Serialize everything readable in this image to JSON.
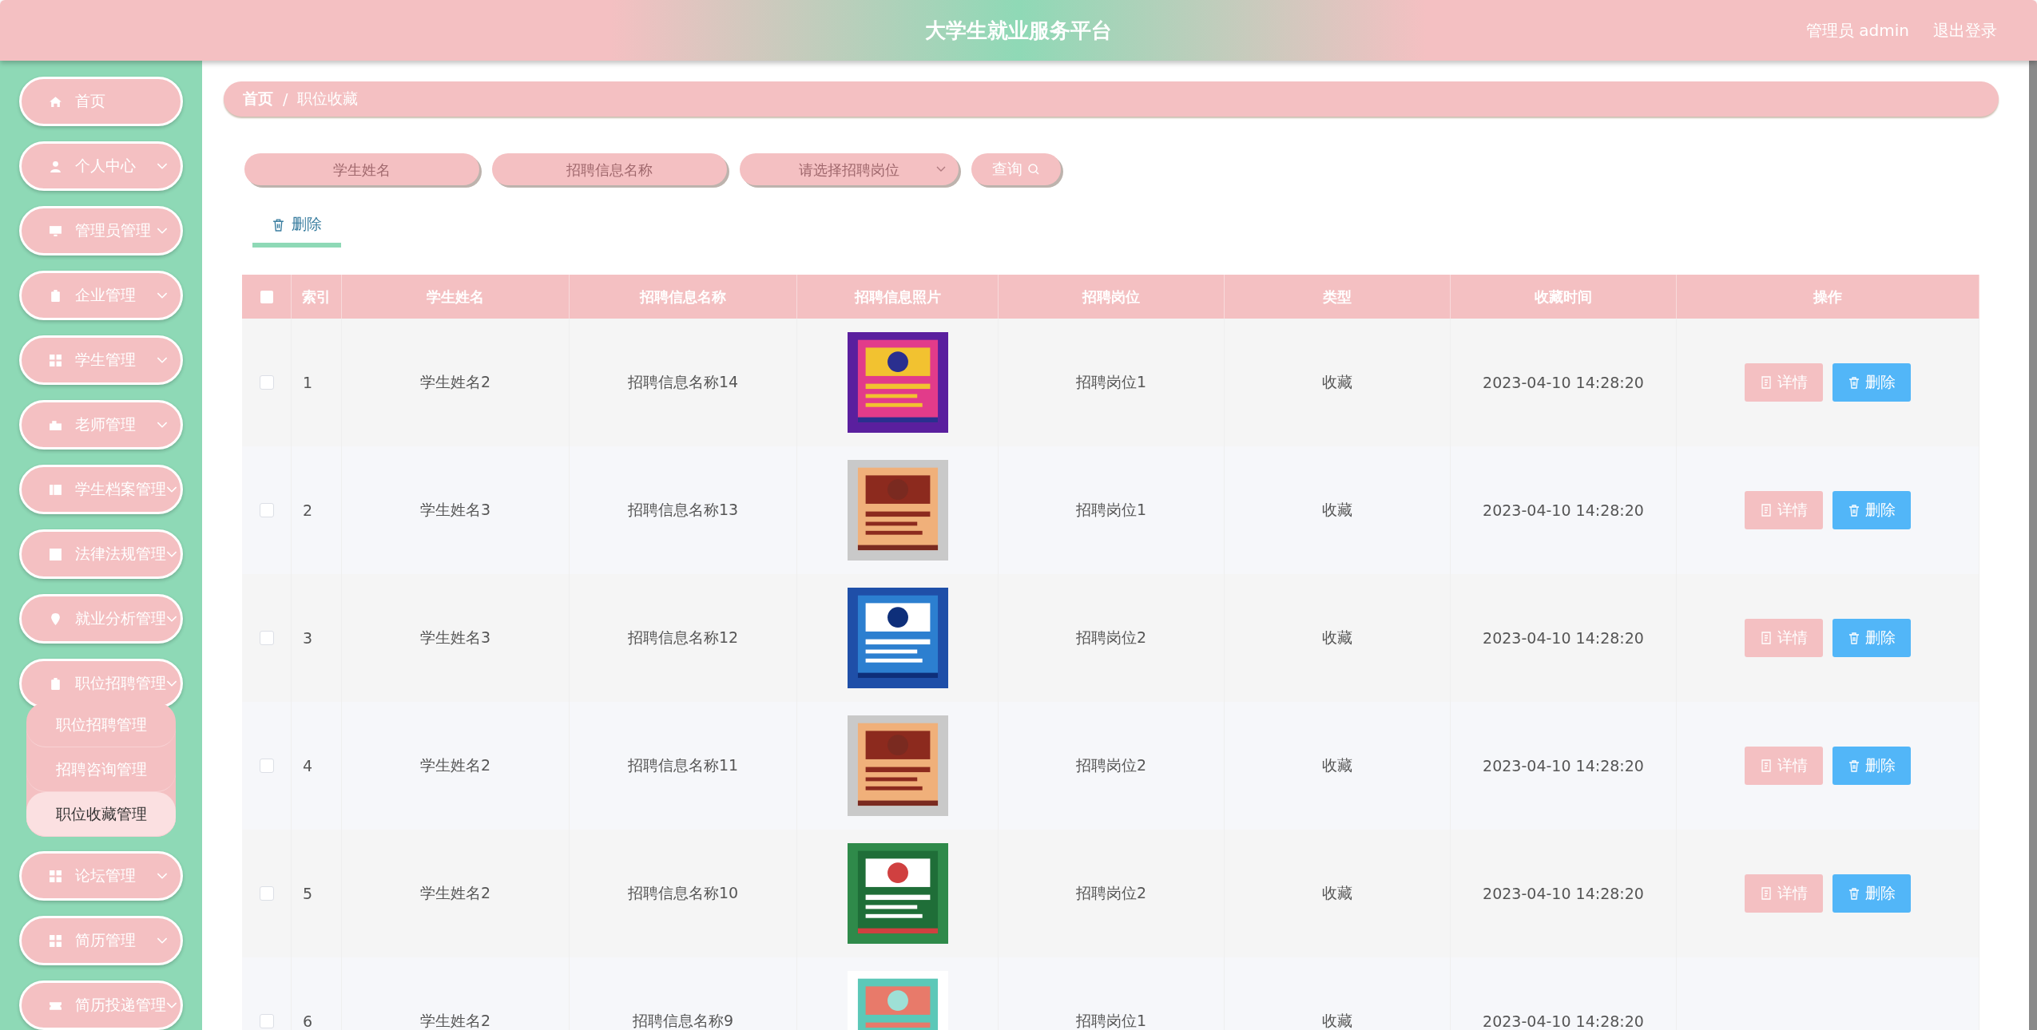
{
  "header": {
    "title": "大学生就业服务平台",
    "user": "管理员 admin",
    "logout": "退出登录"
  },
  "sidebar": {
    "items": [
      {
        "label": "首页",
        "expandable": false
      },
      {
        "label": "个人中心",
        "expandable": true
      },
      {
        "label": "管理员管理",
        "expandable": true
      },
      {
        "label": "企业管理",
        "expandable": true
      },
      {
        "label": "学生管理",
        "expandable": true
      },
      {
        "label": "老师管理",
        "expandable": true
      },
      {
        "label": "学生档案管理",
        "expandable": true
      },
      {
        "label": "法律法规管理",
        "expandable": true
      },
      {
        "label": "就业分析管理",
        "expandable": true
      },
      {
        "label": "职位招聘管理",
        "expandable": true,
        "expanded": true,
        "children": [
          {
            "label": "职位招聘管理",
            "selected": false
          },
          {
            "label": "招聘咨询管理",
            "selected": false
          },
          {
            "label": "职位收藏管理",
            "selected": true
          }
        ]
      },
      {
        "label": "论坛管理",
        "expandable": true
      },
      {
        "label": "简历管理",
        "expandable": true
      },
      {
        "label": "简历投递管理",
        "expandable": true
      }
    ]
  },
  "breadcrumb": [
    "首页",
    "/",
    "职位收藏"
  ],
  "search": {
    "fields": [
      {
        "placeholder": "学生姓名",
        "kind": "input"
      },
      {
        "placeholder": "招聘信息名称",
        "kind": "input"
      },
      {
        "placeholder": "请选择招聘岗位",
        "kind": "select"
      }
    ],
    "button": "查询"
  },
  "toolbar": {
    "delete": "删除"
  },
  "table": {
    "header_checked": false,
    "columns": [
      "索引",
      "学生姓名",
      "招聘信息名称",
      "招聘信息照片",
      "招聘岗位",
      "类型",
      "收藏时间",
      "操作"
    ],
    "rows": [
      {
        "checked": false,
        "index": "1",
        "student": "学生姓名2",
        "name": "招聘信息名称14",
        "photo": {
          "kind": "picture"
        },
        "post": "招聘岗位1",
        "type": "收藏",
        "time": "2023-04-10 14:28:20",
        "actions": [
          {
            "label": "详情",
            "kind": "detail"
          },
          {
            "label": "删除",
            "kind": "delete"
          }
        ]
      },
      {
        "checked": false,
        "index": "2",
        "student": "学生姓名3",
        "name": "招聘信息名称13",
        "photo": {
          "kind": "picture"
        },
        "post": "招聘岗位1",
        "type": "收藏",
        "time": "2023-04-10 14:28:20",
        "actions": [
          {
            "label": "详情",
            "kind": "detail"
          },
          {
            "label": "删除",
            "kind": "delete"
          }
        ]
      },
      {
        "checked": false,
        "index": "3",
        "student": "学生姓名3",
        "name": "招聘信息名称12",
        "photo": {
          "kind": "picture"
        },
        "post": "招聘岗位2",
        "type": "收藏",
        "time": "2023-04-10 14:28:20",
        "actions": [
          {
            "label": "详情",
            "kind": "detail"
          },
          {
            "label": "删除",
            "kind": "delete"
          }
        ]
      },
      {
        "checked": false,
        "index": "4",
        "student": "学生姓名2",
        "name": "招聘信息名称11",
        "photo": {
          "kind": "picture"
        },
        "post": "招聘岗位2",
        "type": "收藏",
        "time": "2023-04-10 14:28:20",
        "actions": [
          {
            "label": "详情",
            "kind": "detail"
          },
          {
            "label": "删除",
            "kind": "delete"
          }
        ]
      },
      {
        "checked": false,
        "index": "5",
        "student": "学生姓名2",
        "name": "招聘信息名称10",
        "photo": {
          "kind": "picture"
        },
        "post": "招聘岗位2",
        "type": "收藏",
        "time": "2023-04-10 14:28:20",
        "actions": [
          {
            "label": "详情",
            "kind": "detail"
          },
          {
            "label": "删除",
            "kind": "delete"
          }
        ]
      },
      {
        "checked": false,
        "index": "6",
        "student": "学生姓名2",
        "name": "招聘信息名称9",
        "photo": {
          "kind": "picture"
        },
        "post": "招聘岗位1",
        "type": "收藏",
        "time": "2023-04-10 14:28:20"
      }
    ]
  }
}
